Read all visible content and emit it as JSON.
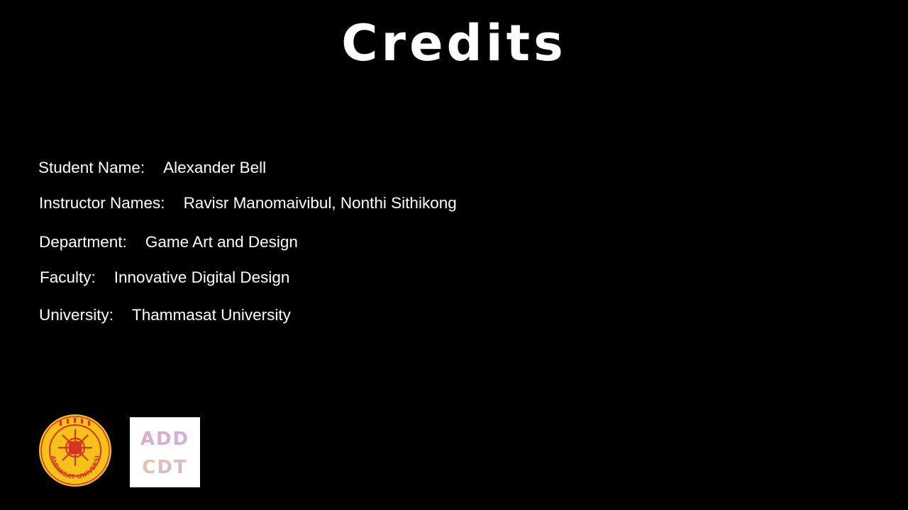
{
  "screen": {
    "title": "Credits"
  },
  "credits": [
    {
      "label": "Student Name:",
      "value": "Alexander Bell"
    },
    {
      "label": "Instructor Names:",
      "value": "Ravisr Manomaivibul, Nonthi Sithikong"
    },
    {
      "label": "Department:",
      "value": "Game Art and Design"
    },
    {
      "label": "Faculty:",
      "value": "Innovative Digital Design"
    },
    {
      "label": "University:",
      "value": "Thammasat University"
    }
  ],
  "logos": {
    "seal_text": "THAMMASAT UNIVERSITY",
    "add_logo_line1": "ADD",
    "add_logo_line2": "CDT"
  },
  "colors": {
    "background": "#000000",
    "text": "#ffffff",
    "seal_gold": "#f6c21a",
    "seal_red": "#d8351f",
    "logo_pink": "#e8a9c4",
    "logo_lilac": "#c9b3e6",
    "logo_peach": "#f2c39a"
  }
}
